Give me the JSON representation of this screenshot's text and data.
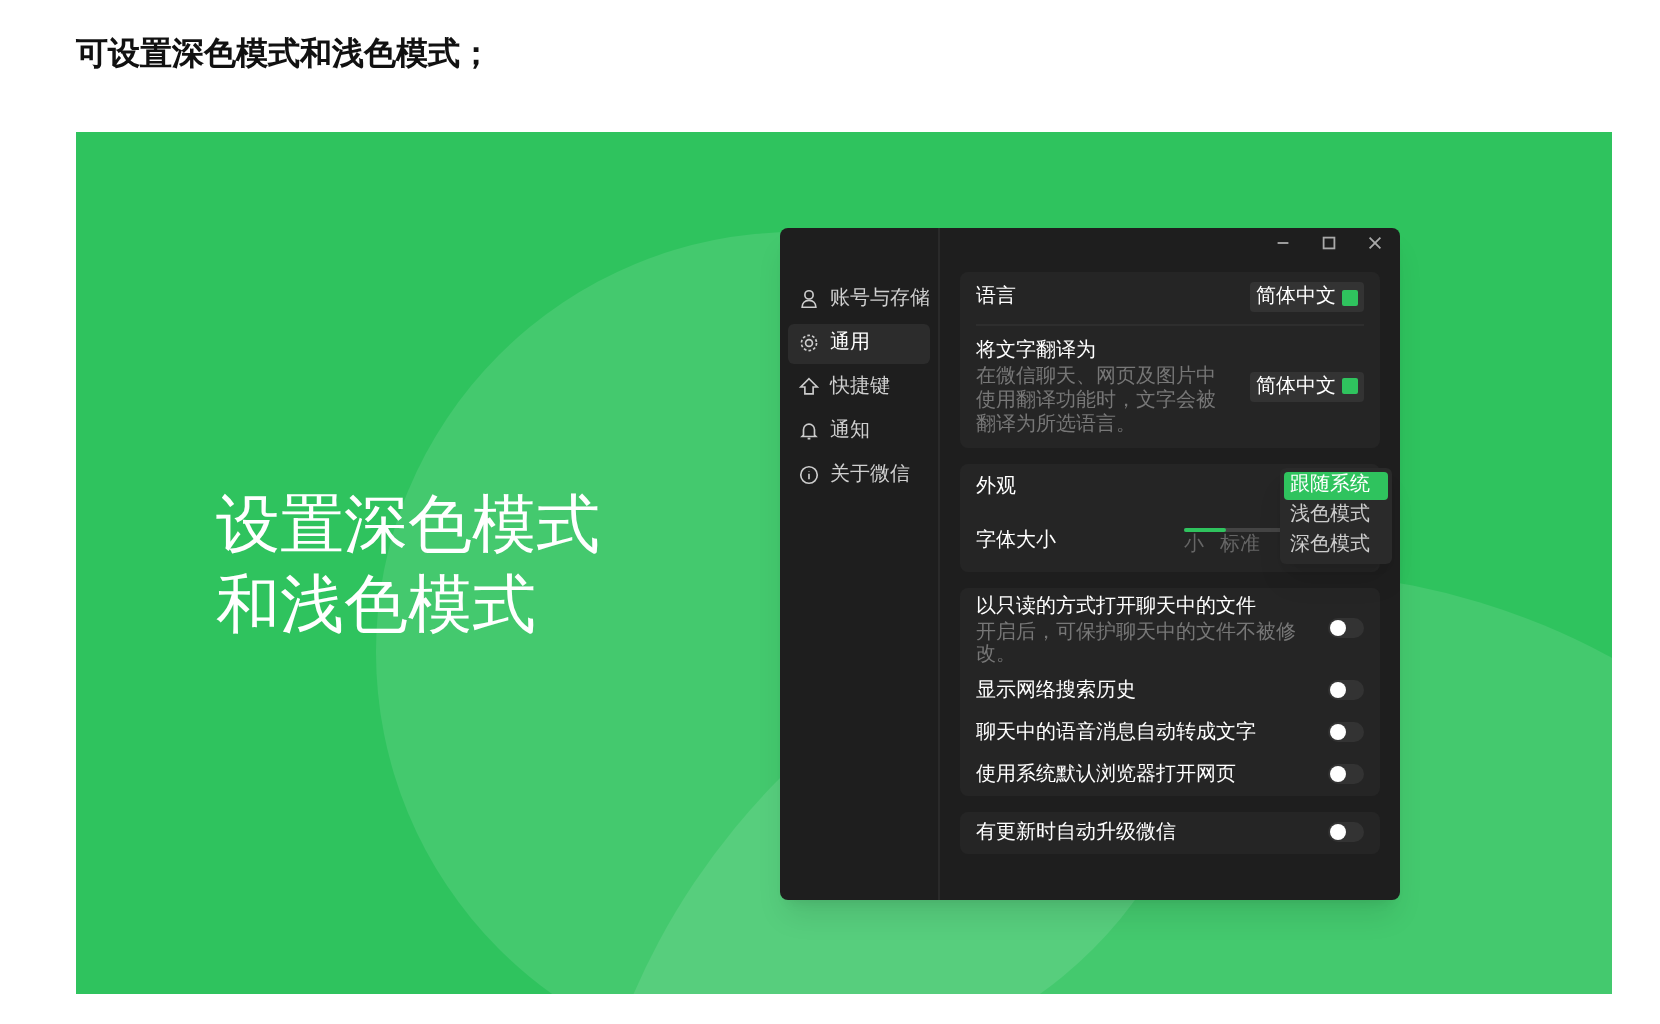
{
  "heading": "可设置深色模式和浅色模式；",
  "banner": {
    "title_lines": [
      "设置深色模式",
      "和浅色模式"
    ]
  },
  "window": {
    "sidebar": {
      "items": [
        {
          "label": "账号与存储",
          "selected": false
        },
        {
          "label": "通用",
          "selected": true
        },
        {
          "label": "快捷键",
          "selected": false
        },
        {
          "label": "通知",
          "selected": false
        },
        {
          "label": "关于微信",
          "selected": false
        }
      ]
    },
    "language": {
      "label": "语言",
      "value": "简体中文"
    },
    "translate": {
      "label": "将文字翻译为",
      "description": "在微信聊天、网页及图片中使用翻译功能时，文字会被翻译为所选语言。",
      "value": "简体中文"
    },
    "appearance": {
      "label": "外观",
      "dropdown": [
        {
          "label": "跟随系统",
          "selected": true
        },
        {
          "label": "浅色模式",
          "selected": false
        },
        {
          "label": "深色模式",
          "selected": false
        }
      ]
    },
    "font_size": {
      "label": "字体大小",
      "level": 0.3,
      "tick_labels": [
        "小",
        "标准"
      ]
    },
    "toggle_groups": [
      [
        {
          "label": "以只读的方式打开聊天中的文件",
          "description": "开启后，可保护聊天中的文件不被修改。",
          "on": false
        },
        {
          "label": "显示网络搜索历史",
          "on": false
        },
        {
          "label": "聊天中的语音消息自动转成文字",
          "on": false
        },
        {
          "label": "使用系统默认浏览器打开网页",
          "on": false
        }
      ],
      [
        {
          "label": "有更新时自动升级微信",
          "on": false
        }
      ]
    ]
  }
}
